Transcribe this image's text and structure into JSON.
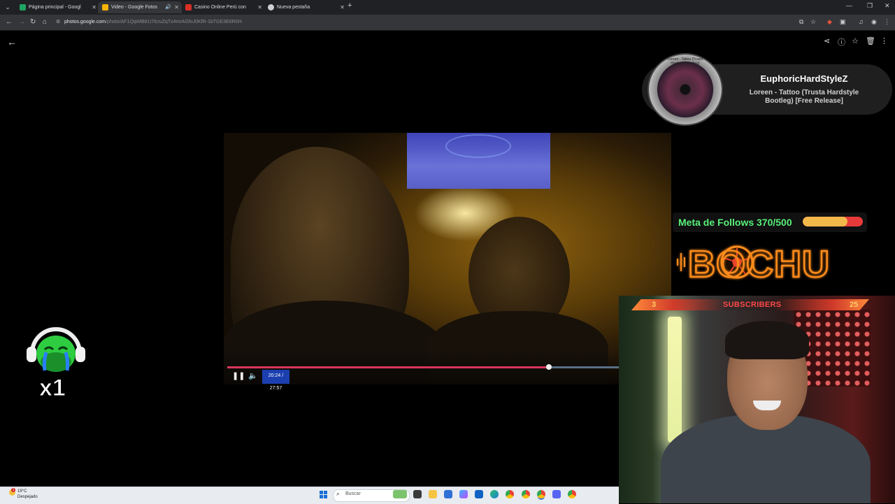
{
  "browser": {
    "tabs": [
      {
        "title": "Página principal - Google Drive",
        "favicon_color": "#1fa463",
        "active": false
      },
      {
        "title": "Video - Google Fotos",
        "favicon_color": "#f4b400",
        "active": true,
        "audio": true
      },
      {
        "title": "Casino Online Perú con Juegos",
        "favicon_color": "#d93025",
        "active": false
      },
      {
        "title": "Nueva pestaña",
        "favicon_color": "#cfcfcf",
        "active": false
      }
    ],
    "url_host": "photos.google.com",
    "url_path": "/photo/AF1QipMB81t7lcruZqTz4mrAGfoJ0KfR-1bTGE3E6R0H"
  },
  "viewer": {
    "time_display": "20:24 / 27:57",
    "progress_fraction": 0.822
  },
  "music": {
    "channel": "EuphoricHardStyleZ",
    "track_line1": "Loreen - Tattoo (Trusta Hardstyle",
    "track_line2": "Bootleg) [Free Release]",
    "disc_label": "Loreen - Tattoo (Trusta Hardstyle Bootleg)"
  },
  "goal": {
    "text": "Meta de Follows 370/500",
    "current": 370,
    "target": 500
  },
  "logo_text": "BOCHU",
  "subs": {
    "left": "3",
    "title": "SUBSCRIBERS",
    "right": "25"
  },
  "emote": {
    "multiplier": "x1"
  },
  "taskbar": {
    "weather_temp": "19°C",
    "weather_desc": "Despejado",
    "weather_alert": "1",
    "search_placeholder": "Buscar",
    "apps": [
      "widgets",
      "file-explorer",
      "files",
      "store",
      "copilot",
      "outlook",
      "edge",
      "chrome",
      "chrome-profile-1",
      "chrome-profile-2",
      "discord",
      "chrome-profile-3"
    ]
  },
  "colors": {
    "accent_progress": "#d8365b",
    "goal_text": "#58f07a",
    "logo_orange": "#ff8c1a",
    "time_box": "#1c3fb0"
  }
}
